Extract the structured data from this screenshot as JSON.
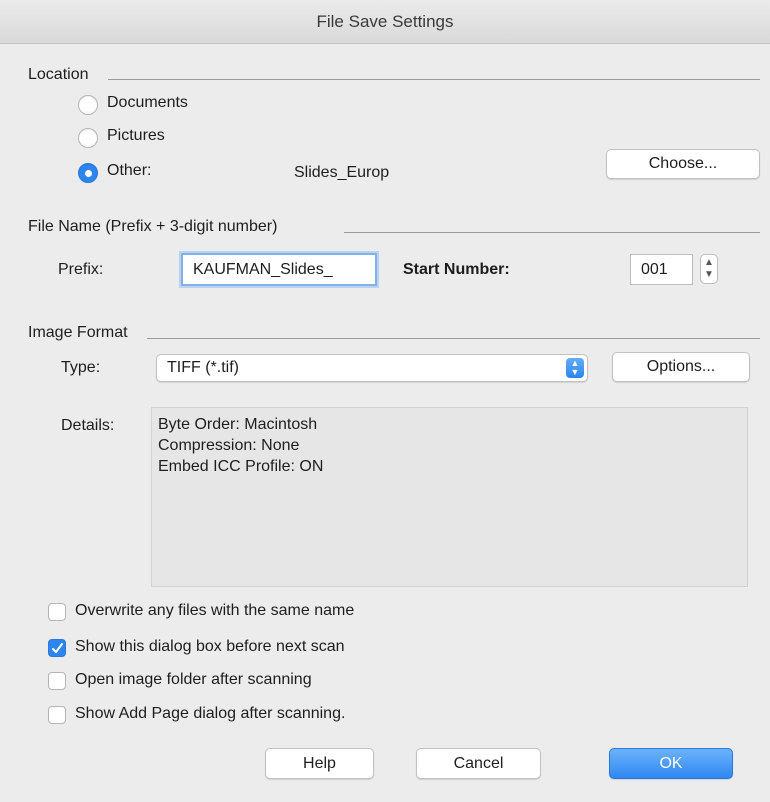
{
  "window": {
    "title": "File Save Settings"
  },
  "location": {
    "label": "Location",
    "options": [
      "Documents",
      "Pictures",
      "Other:"
    ],
    "selected_index": 2,
    "other_value": "Slides_Europ",
    "choose_label": "Choose..."
  },
  "file_name": {
    "label": "File Name (Prefix + 3-digit number)",
    "prefix_label": "Prefix:",
    "prefix_value": "KAUFMAN_Slides_",
    "start_label": "Start Number:",
    "start_value": "001"
  },
  "image_format": {
    "label": "Image Format",
    "type_label": "Type:",
    "type_value": "TIFF (*.tif)",
    "options_label": "Options...",
    "details_label": "Details:",
    "details_lines": [
      "Byte Order: Macintosh",
      "Compression: None",
      "Embed ICC Profile: ON"
    ]
  },
  "checkboxes": [
    {
      "label": "Overwrite any files with the same name",
      "checked": false
    },
    {
      "label": "Show this dialog box before next scan",
      "checked": true
    },
    {
      "label": "Open image folder after scanning",
      "checked": false
    },
    {
      "label": "Show Add Page dialog after scanning.",
      "checked": false
    }
  ],
  "buttons": {
    "help": "Help",
    "cancel": "Cancel",
    "ok": "OK"
  },
  "colors": {
    "accent": "#2d86f0",
    "background": "#ececec"
  }
}
